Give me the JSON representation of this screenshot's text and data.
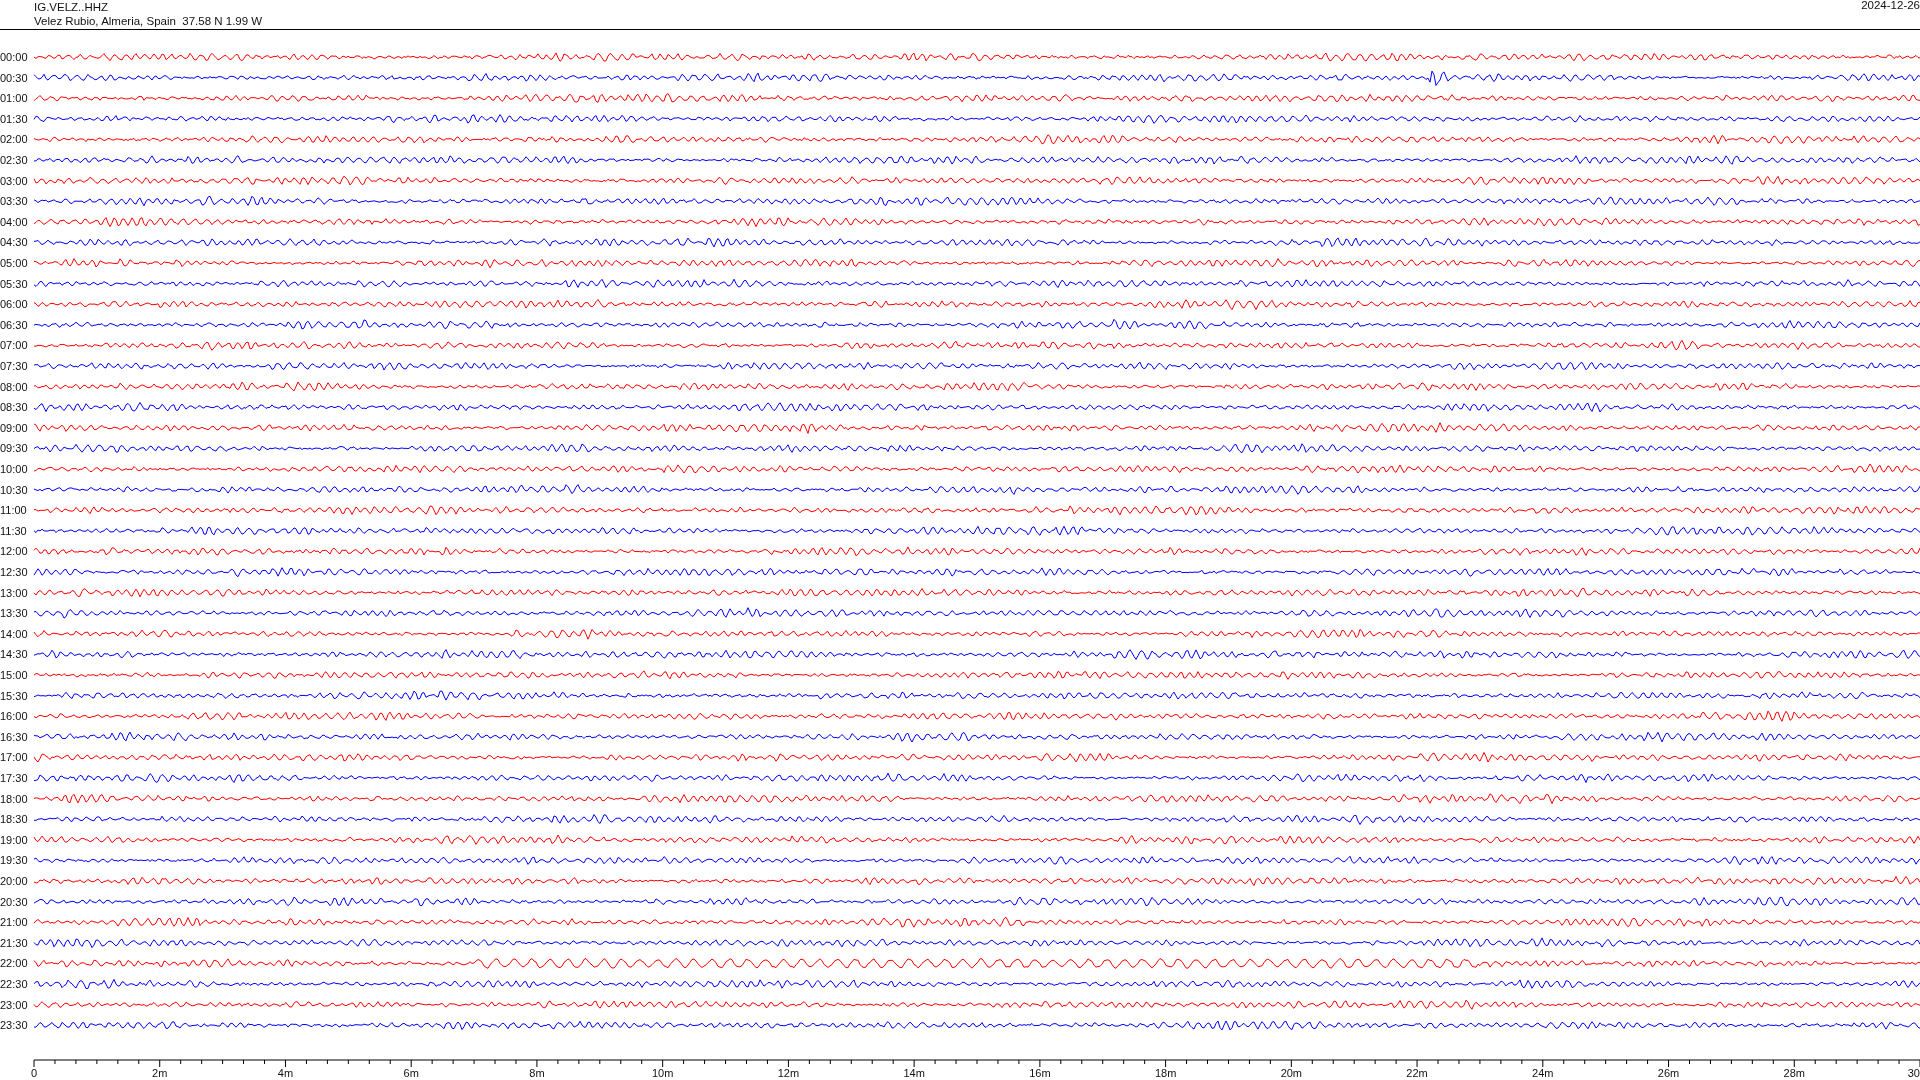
{
  "header": {
    "station": "IG.VELZ..HHZ",
    "location": "Velez Rubio, Almeria, Spain  37.58 N 1.99 W",
    "date": "2024-12-26"
  },
  "rows": [
    {
      "time": "00:00",
      "color": "#ff0000"
    },
    {
      "time": "00:30",
      "color": "#0000ff"
    },
    {
      "time": "01:00",
      "color": "#ff0000"
    },
    {
      "time": "01:30",
      "color": "#0000ff"
    },
    {
      "time": "02:00",
      "color": "#ff0000"
    },
    {
      "time": "02:30",
      "color": "#0000ff"
    },
    {
      "time": "03:00",
      "color": "#ff0000"
    },
    {
      "time": "03:30",
      "color": "#0000ff"
    },
    {
      "time": "04:00",
      "color": "#ff0000"
    },
    {
      "time": "04:30",
      "color": "#0000ff"
    },
    {
      "time": "05:00",
      "color": "#ff0000"
    },
    {
      "time": "05:30",
      "color": "#0000ff"
    },
    {
      "time": "06:00",
      "color": "#ff0000"
    },
    {
      "time": "06:30",
      "color": "#0000ff"
    },
    {
      "time": "07:00",
      "color": "#ff0000"
    },
    {
      "time": "07:30",
      "color": "#0000ff"
    },
    {
      "time": "08:00",
      "color": "#ff0000"
    },
    {
      "time": "08:30",
      "color": "#0000ff"
    },
    {
      "time": "09:00",
      "color": "#ff0000"
    },
    {
      "time": "09:30",
      "color": "#0000ff"
    },
    {
      "time": "10:00",
      "color": "#ff0000"
    },
    {
      "time": "10:30",
      "color": "#0000ff"
    },
    {
      "time": "11:00",
      "color": "#ff0000"
    },
    {
      "time": "11:30",
      "color": "#0000ff"
    },
    {
      "time": "12:00",
      "color": "#ff0000"
    },
    {
      "time": "12:30",
      "color": "#0000ff"
    },
    {
      "time": "13:00",
      "color": "#ff0000"
    },
    {
      "time": "13:30",
      "color": "#0000ff"
    },
    {
      "time": "14:00",
      "color": "#ff0000"
    },
    {
      "time": "14:30",
      "color": "#0000ff"
    },
    {
      "time": "15:00",
      "color": "#ff0000"
    },
    {
      "time": "15:30",
      "color": "#0000ff"
    },
    {
      "time": "16:00",
      "color": "#ff0000"
    },
    {
      "time": "16:30",
      "color": "#0000ff"
    },
    {
      "time": "17:00",
      "color": "#ff0000"
    },
    {
      "time": "17:30",
      "color": "#0000ff"
    },
    {
      "time": "18:00",
      "color": "#ff0000"
    },
    {
      "time": "18:30",
      "color": "#0000ff"
    },
    {
      "time": "19:00",
      "color": "#ff0000"
    },
    {
      "time": "19:30",
      "color": "#0000ff"
    },
    {
      "time": "20:00",
      "color": "#ff0000"
    },
    {
      "time": "20:30",
      "color": "#0000ff"
    },
    {
      "time": "21:00",
      "color": "#ff0000"
    },
    {
      "time": "21:30",
      "color": "#0000ff"
    },
    {
      "time": "22:00",
      "color": "#ff0000"
    },
    {
      "time": "22:30",
      "color": "#0000ff"
    },
    {
      "time": "23:00",
      "color": "#ff0000"
    },
    {
      "time": "23:30",
      "color": "#0000ff"
    }
  ],
  "axis": {
    "labels": [
      "0",
      "2m",
      "4m",
      "6m",
      "8m",
      "10m",
      "12m",
      "14m",
      "16m",
      "18m",
      "20m",
      "22m",
      "24m",
      "26m",
      "28m",
      "30"
    ]
  }
}
